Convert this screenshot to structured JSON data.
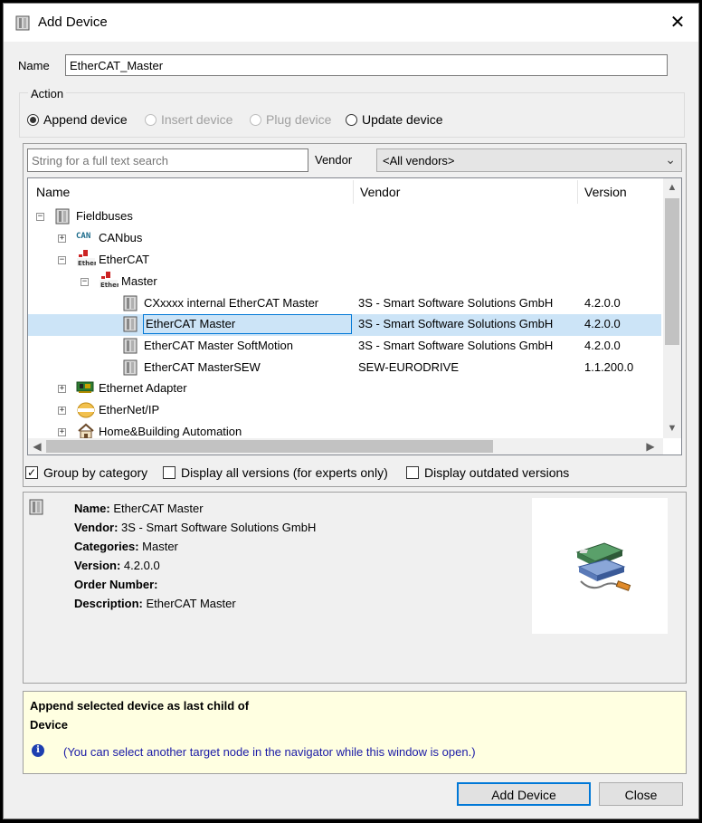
{
  "window": {
    "title": "Add Device",
    "close_glyph": "✕"
  },
  "name_field": {
    "label": "Name",
    "value": "EtherCAT_Master"
  },
  "action": {
    "title": "Action",
    "options": [
      {
        "label": "Append device",
        "selected": true,
        "enabled": true
      },
      {
        "label": "Insert device",
        "selected": false,
        "enabled": false
      },
      {
        "label": "Plug device",
        "selected": false,
        "enabled": false
      },
      {
        "label": "Update device",
        "selected": false,
        "enabled": true
      }
    ]
  },
  "search": {
    "placeholder": "String for a full text search"
  },
  "vendor": {
    "label": "Vendor",
    "selected": "<All vendors>"
  },
  "table": {
    "columns": [
      "Name",
      "Vendor",
      "Version"
    ],
    "rows": [
      {
        "name": "Fieldbuses",
        "vendor": "",
        "version": "",
        "icon": "fieldbus-icon"
      },
      {
        "name": "CANbus",
        "vendor": "",
        "version": "",
        "icon": "can-icon",
        "prefix": "CAN"
      },
      {
        "name": "EtherCAT",
        "vendor": "",
        "version": "",
        "icon": "ethercat-icon"
      },
      {
        "name": "Master",
        "vendor": "",
        "version": "",
        "icon": "ethercat-icon"
      },
      {
        "name": "CXxxxx internal EtherCAT Master",
        "vendor": "3S - Smart Software Solutions GmbH",
        "version": "4.2.0.0",
        "icon": "device-icon"
      },
      {
        "name": "EtherCAT Master",
        "vendor": "3S - Smart Software Solutions GmbH",
        "version": "4.2.0.0",
        "icon": "device-icon"
      },
      {
        "name": "EtherCAT Master SoftMotion",
        "vendor": "3S - Smart Software Solutions GmbH",
        "version": "4.2.0.0",
        "icon": "device-icon"
      },
      {
        "name": "EtherCAT MasterSEW",
        "vendor": "SEW-EURODRIVE",
        "version": "1.1.200.0",
        "icon": "device-icon"
      },
      {
        "name": "Ethernet Adapter",
        "vendor": "",
        "version": "",
        "icon": "network-card-icon"
      },
      {
        "name": "EtherNet/IP",
        "vendor": "",
        "version": "",
        "icon": "ethernet-ip-icon"
      },
      {
        "name": "Home&Building Automation",
        "vendor": "",
        "version": "",
        "icon": "home-icon"
      }
    ]
  },
  "options": {
    "group_by_category": {
      "label": "Group by category",
      "checked": true
    },
    "display_all_versions": {
      "label": "Display all versions (for experts only)",
      "checked": false
    },
    "display_outdated": {
      "label": "Display outdated versions",
      "checked": false
    }
  },
  "details": {
    "name_label": "Name:",
    "name_value": "EtherCAT Master",
    "vendor_label": "Vendor:",
    "vendor_value": "3S - Smart Software Solutions GmbH",
    "categories_label": "Categories:",
    "categories_value": "Master",
    "version_label": "Version:",
    "version_value": "4.2.0.0",
    "order_label": "Order Number:",
    "order_value": "",
    "description_label": "Description:",
    "description_value": "EtherCAT Master"
  },
  "message": {
    "line1": "Append selected device as last child of",
    "line2": "Device",
    "hint": "(You can select another target node in the navigator while this window is open.)"
  },
  "buttons": {
    "add_label": "Add Device",
    "close_label": "Close"
  },
  "colors": {
    "selection": "#cce4f7",
    "focus": "#0078d7",
    "message_bg": "#ffffe1",
    "hint_text": "#1a1aa6"
  }
}
